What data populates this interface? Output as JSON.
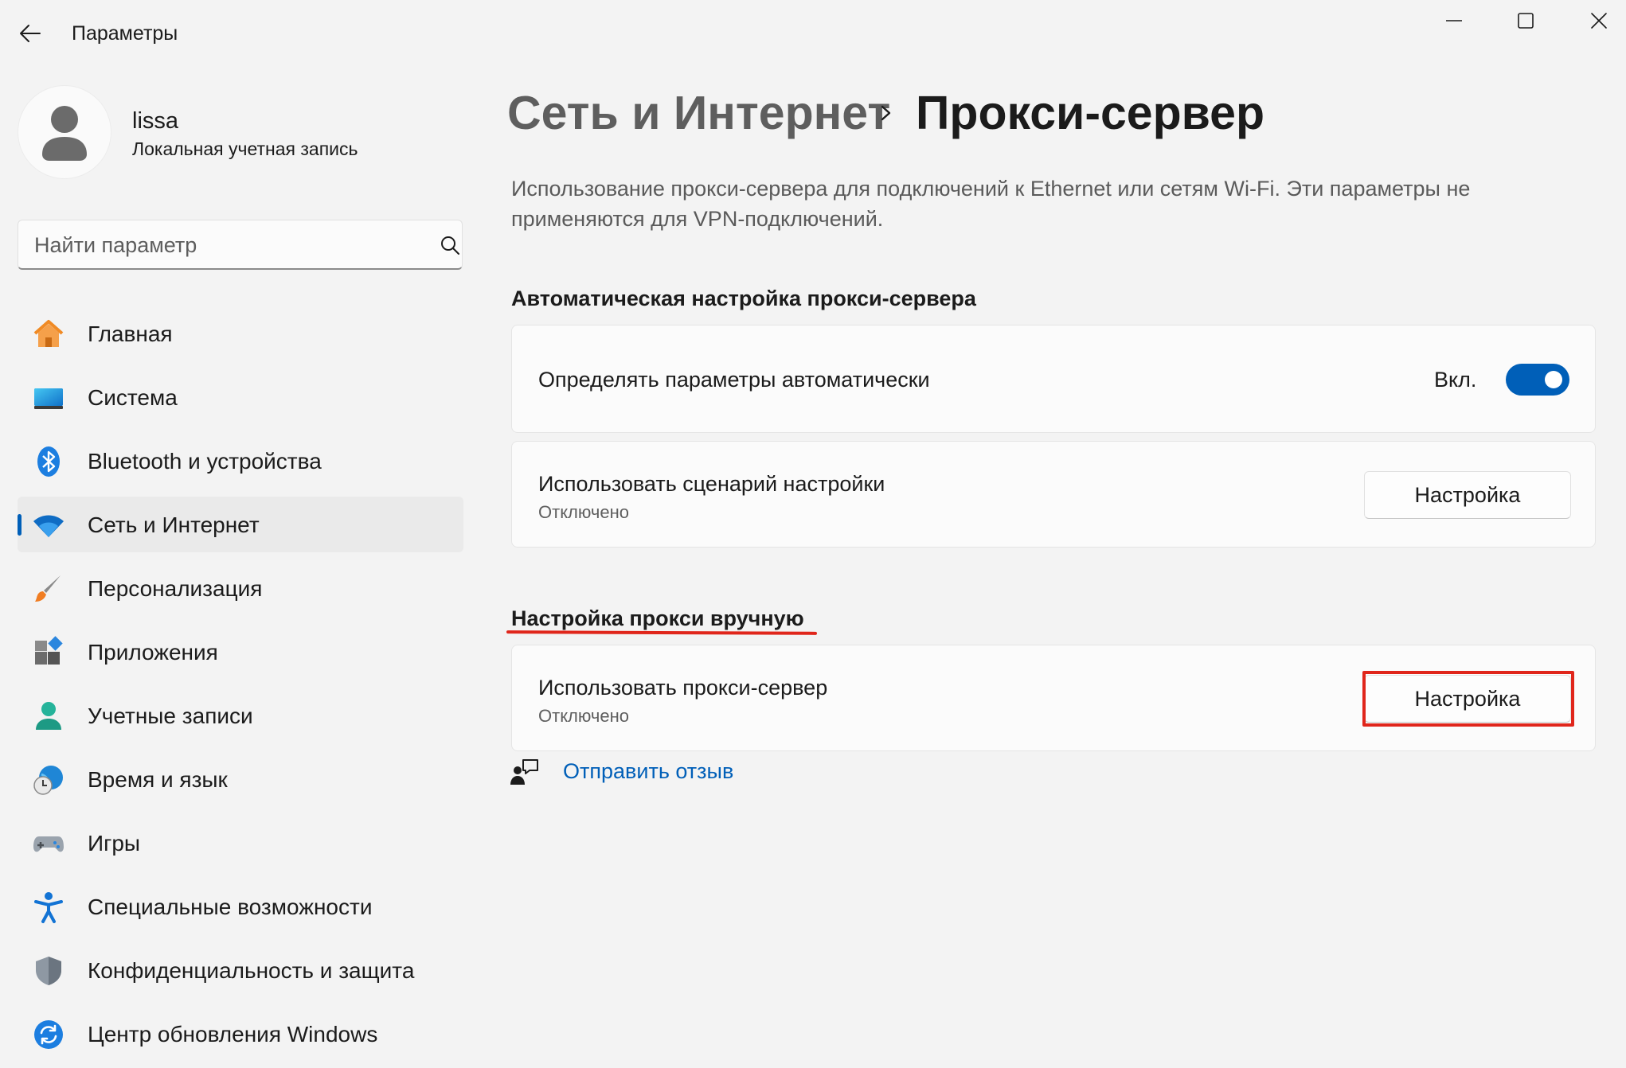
{
  "window": {
    "title": "Параметры"
  },
  "profile": {
    "name": "lissa",
    "account_type": "Локальная учетная запись"
  },
  "search": {
    "placeholder": "Найти параметр"
  },
  "sidebar": {
    "items": [
      {
        "label": "Главная",
        "icon": "home-icon",
        "selected": false
      },
      {
        "label": "Система",
        "icon": "system-icon",
        "selected": false
      },
      {
        "label": "Bluetooth и устройства",
        "icon": "bluetooth-icon",
        "selected": false
      },
      {
        "label": "Сеть и Интернет",
        "icon": "wifi-icon",
        "selected": true
      },
      {
        "label": "Персонализация",
        "icon": "brush-icon",
        "selected": false
      },
      {
        "label": "Приложения",
        "icon": "apps-icon",
        "selected": false
      },
      {
        "label": "Учетные записи",
        "icon": "accounts-icon",
        "selected": false
      },
      {
        "label": "Время и язык",
        "icon": "time-language-icon",
        "selected": false
      },
      {
        "label": "Игры",
        "icon": "gamepad-icon",
        "selected": false
      },
      {
        "label": "Специальные возможности",
        "icon": "accessibility-icon",
        "selected": false
      },
      {
        "label": "Конфиденциальность и защита",
        "icon": "shield-icon",
        "selected": false
      },
      {
        "label": "Центр обновления Windows",
        "icon": "update-icon",
        "selected": false
      }
    ]
  },
  "breadcrumb": {
    "parent": "Сеть и Интернет",
    "current": "Прокси-сервер"
  },
  "description": "Использование прокси-сервера для подключений к Ethernet или сетям Wi-Fi. Эти параметры не применяются для VPN-подключений.",
  "auto_section": {
    "title": "Автоматическая настройка прокси-сервера",
    "detect": {
      "label": "Определять параметры автоматически",
      "state_label": "Вкл.",
      "enabled": true
    },
    "script": {
      "label": "Использовать сценарий настройки",
      "status": "Отключено",
      "button": "Настройка"
    }
  },
  "manual_section": {
    "title": "Настройка прокси вручную",
    "proxy": {
      "label": "Использовать прокси-сервер",
      "status": "Отключено",
      "button": "Настройка"
    }
  },
  "feedback": {
    "label": "Отправить отзыв"
  },
  "colors": {
    "accent": "#005fb8",
    "highlight": "#e0261b",
    "background": "#f3f3f3"
  }
}
